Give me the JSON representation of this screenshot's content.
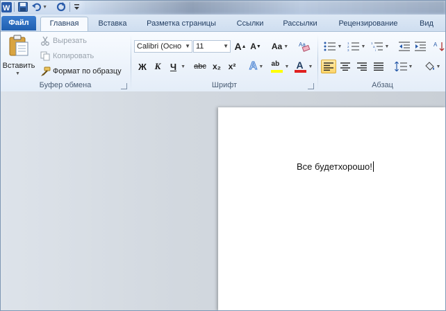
{
  "quick_access": {
    "app_icon": "word-app-icon",
    "save_icon": "save-icon",
    "undo_icon": "undo-icon",
    "redo_icon": "redo-icon",
    "customize_icon": "customize-qat-icon"
  },
  "tabs": [
    {
      "label": "Файл"
    },
    {
      "label": "Главная"
    },
    {
      "label": "Вставка"
    },
    {
      "label": "Разметка страницы"
    },
    {
      "label": "Ссылки"
    },
    {
      "label": "Рассылки"
    },
    {
      "label": "Рецензирование"
    },
    {
      "label": "Вид"
    }
  ],
  "clipboard": {
    "paste_label": "Вставить",
    "cut_label": "Вырезать",
    "copy_label": "Копировать",
    "format_painter_label": "Формат по образцу",
    "group_label": "Буфер обмена"
  },
  "font": {
    "font_name": "Calibri (Осно",
    "font_size": "11",
    "grow_label": "A",
    "shrink_label": "A",
    "case_label": "Aa",
    "bold_label": "Ж",
    "italic_label": "К",
    "underline_label": "Ч",
    "strike_label": "abc",
    "subscript_label": "x₂",
    "superscript_label": "x²",
    "text_effects_label": "A",
    "highlight_label": "ab",
    "font_color_label": "A",
    "group_label": "Шрифт",
    "highlight_color": "#ffff00",
    "font_color": "#e02020"
  },
  "paragraph": {
    "group_label": "Абзац"
  },
  "document": {
    "text": "Все будетхорошо!"
  }
}
